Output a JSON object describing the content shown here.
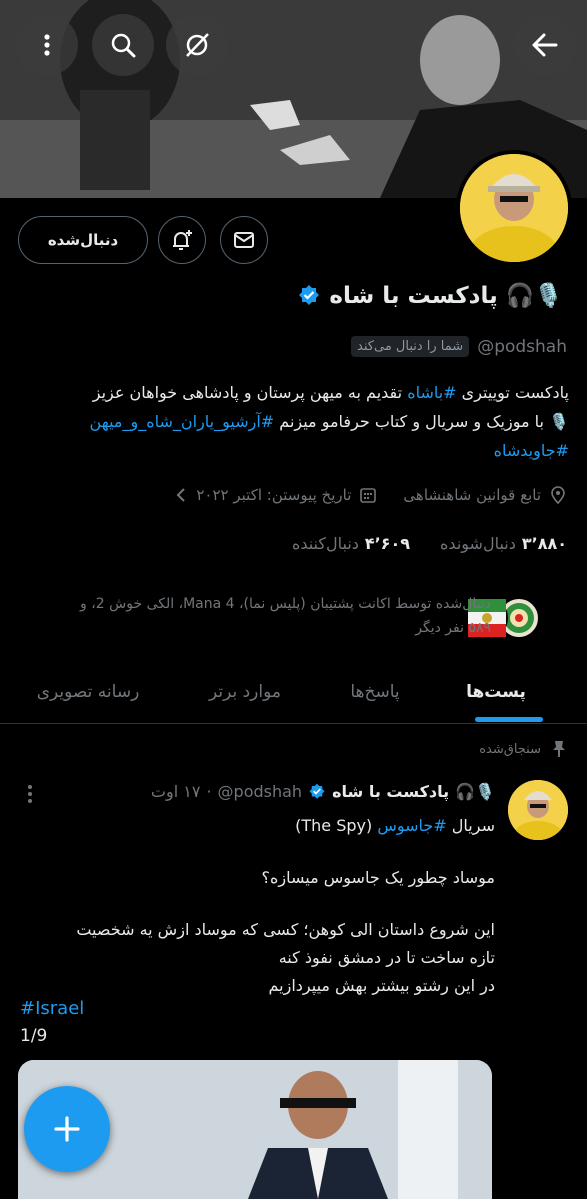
{
  "header": {
    "back_icon": "arrow-right-icon",
    "hide_icon": "eye-slash-icon",
    "search_icon": "search-icon",
    "more_icon": "more-vertical-icon"
  },
  "actions": {
    "follow_label": "دنبال‌شده",
    "notify_icon": "bell-plus-icon",
    "message_icon": "mail-icon"
  },
  "profile": {
    "name": "پادکست با شاه",
    "name_emojis": "🎙️🎧",
    "handle": "@podshah",
    "follows_you": "شما را دنبال می‌کند",
    "bio_line1_a": "پادکست توییتری ",
    "bio_line1_tag": "#باشاه",
    "bio_line1_b": "  تقدیم به میهن پرستان و پادشاهی خواهان عزیز",
    "bio_line2_a": "🎙️ با موزیک و سریال و کتاب حرفامو میزنم  ",
    "bio_line2_tag": "#آرشیو_یاران_شاه_و_میهن",
    "bio_line3_tag": "#جاویدشاه",
    "location": "تابع قوانین شاهنشاهی",
    "joined": "تاریخ پیوستن: اکتبر ۲۰۲۲",
    "following_count": "۳٬۸۸۰",
    "following_label": "دنبال‌شونده",
    "followers_count": "۴٬۶۰۹",
    "followers_label": "دنبال‌کننده",
    "followed_by_line1": "دنبال‌شده توسط اکانت پشتیبان (پلیس نما)، Mana 4، الکی خوش 2، و",
    "followed_by_line2": "۵۸۹ نفر دیگر"
  },
  "tabs": [
    {
      "label": "پست‌ها",
      "active": true
    },
    {
      "label": "پاسخ‌ها",
      "active": false
    },
    {
      "label": "موارد برتر",
      "active": false
    },
    {
      "label": "رسانه تصویری",
      "active": false
    }
  ],
  "post": {
    "pinned_label": "سنجاق‌شده",
    "author": "پادکست با شاه",
    "author_emojis": "🎙️🎧",
    "handle": "@podshah",
    "time": "۱۷ اوت",
    "line1_a": "سریال ",
    "line1_tag": "#جاسوس",
    "line1_b": " (The Spy)",
    "line2": "موساد چطور یک جاسوس میسازه؟",
    "line3": "این شروع داستان الی کوهن؛ کسی که موساد ازش یه شخصیت",
    "line4": "تازه ساخت تا در دمشق نفوذ کنه",
    "line5": "در این رشتو بیشتر بهش میپردازیم",
    "tag": "#Israel",
    "counter": "1/9"
  },
  "fab": {
    "icon": "plus-icon"
  },
  "colors": {
    "accent": "#1d9bf0",
    "background": "#000000",
    "muted": "#71767b",
    "verified": "#1d9bf0"
  }
}
